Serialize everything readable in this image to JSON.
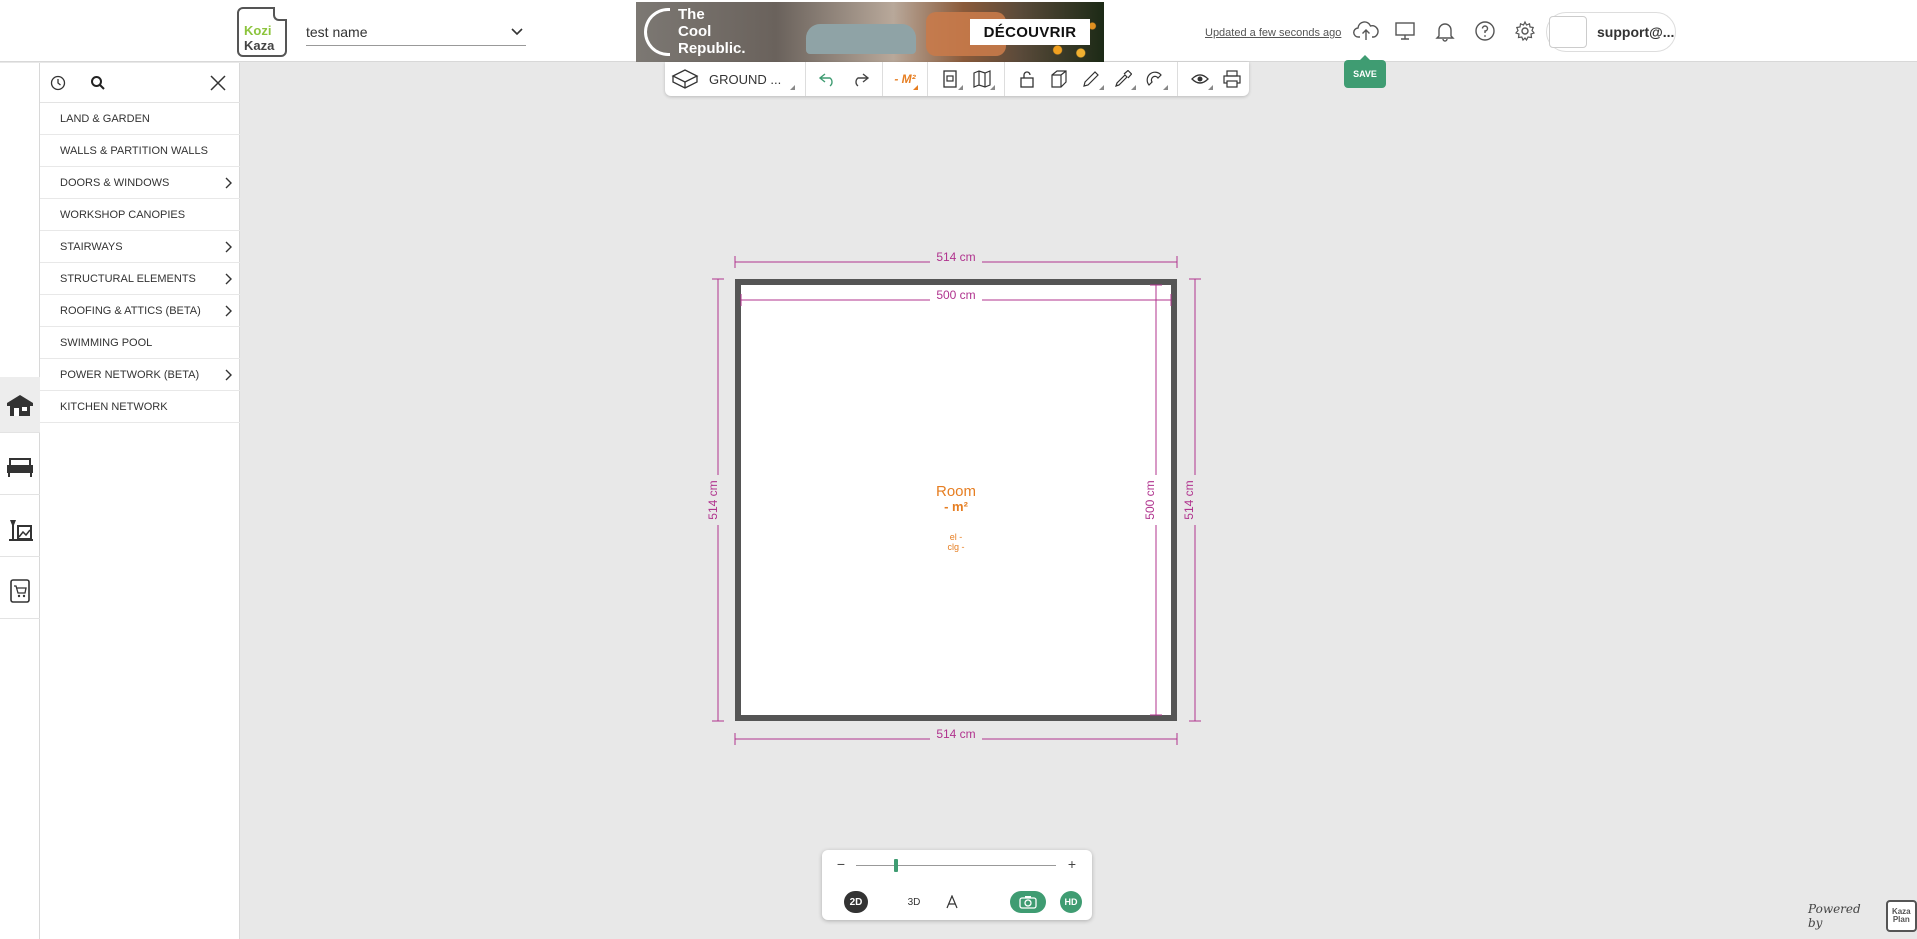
{
  "header": {
    "logo_line1": "Kozi",
    "logo_line2": "Kaza",
    "project_name": "test name",
    "status_text": "Updated a few seconds ago",
    "save_label": "SAVE",
    "user_email": "support@..."
  },
  "ad": {
    "brand_line1": "The",
    "brand_line2": "Cool",
    "brand_line3": "Republic.",
    "cta": "DÉCOUVRIR"
  },
  "panel": {
    "categories": [
      {
        "label": "LAND & GARDEN",
        "has_submenu": false
      },
      {
        "label": "WALLS & PARTITION WALLS",
        "has_submenu": false
      },
      {
        "label": "DOORS & WINDOWS",
        "has_submenu": true
      },
      {
        "label": "WORKSHOP CANOPIES",
        "has_submenu": false
      },
      {
        "label": "STAIRWAYS",
        "has_submenu": true
      },
      {
        "label": "STRUCTURAL ELEMENTS",
        "has_submenu": true
      },
      {
        "label": "ROOFING & ATTICS (BETA)",
        "has_submenu": true
      },
      {
        "label": "SWIMMING POOL",
        "has_submenu": false
      },
      {
        "label": "POWER NETWORK (BETA)",
        "has_submenu": true
      },
      {
        "label": "KITCHEN NETWORK",
        "has_submenu": false
      }
    ]
  },
  "toolbar": {
    "floor_label": "GROUND ...",
    "area_label": "- M²"
  },
  "plan": {
    "outer_top": "514 cm",
    "outer_bottom": "514 cm",
    "outer_left": "514 cm",
    "outer_right": "514 cm",
    "inner_top": "500 cm",
    "inner_right": "500 cm",
    "room_name": "Room",
    "room_area": "- m²",
    "room_el": "el -",
    "room_clg": "clg -"
  },
  "view": {
    "mode_2d": "2D",
    "mode_3d": "3D",
    "mode_text": "A",
    "hd": "HD",
    "zoom_minus": "−",
    "zoom_plus": "+",
    "zoom_level": 0.2
  },
  "footer": {
    "powered_by": "Powered by",
    "powered_logo": "Kaza Plan"
  },
  "colors": {
    "accent": "#3f9c72",
    "dimension": "#b0338e",
    "room_label": "#e67e22",
    "wall": "#555555"
  }
}
